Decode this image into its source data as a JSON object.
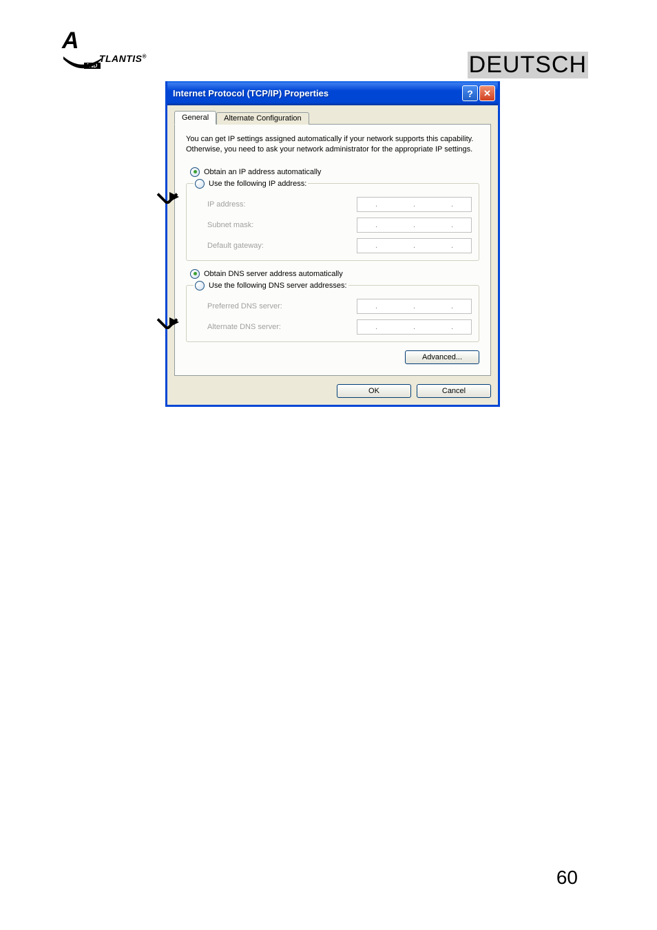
{
  "header": {
    "logo_text": "TLANTIS",
    "logo_letter": "A",
    "logo_sub": "AND",
    "reg": "®",
    "language": "DEUTSCH"
  },
  "dialog": {
    "title": "Internet Protocol (TCP/IP) Properties",
    "tabs": {
      "general": "General",
      "alternate": "Alternate Configuration"
    },
    "description": "You can get IP settings assigned automatically if your network supports this capability. Otherwise, you need to ask your network administrator for the appropriate IP settings.",
    "ip_section": {
      "auto_label": "Obtain an IP address automatically",
      "manual_label": "Use the following IP address:",
      "ip_address": "IP address:",
      "subnet": "Subnet mask:",
      "gateway": "Default gateway:"
    },
    "dns_section": {
      "auto_label": "Obtain DNS server address automatically",
      "manual_label": "Use the following DNS server addresses:",
      "preferred": "Preferred DNS server:",
      "alternate": "Alternate DNS server:"
    },
    "buttons": {
      "advanced": "Advanced...",
      "ok": "OK",
      "cancel": "Cancel"
    }
  },
  "page_number": "60"
}
